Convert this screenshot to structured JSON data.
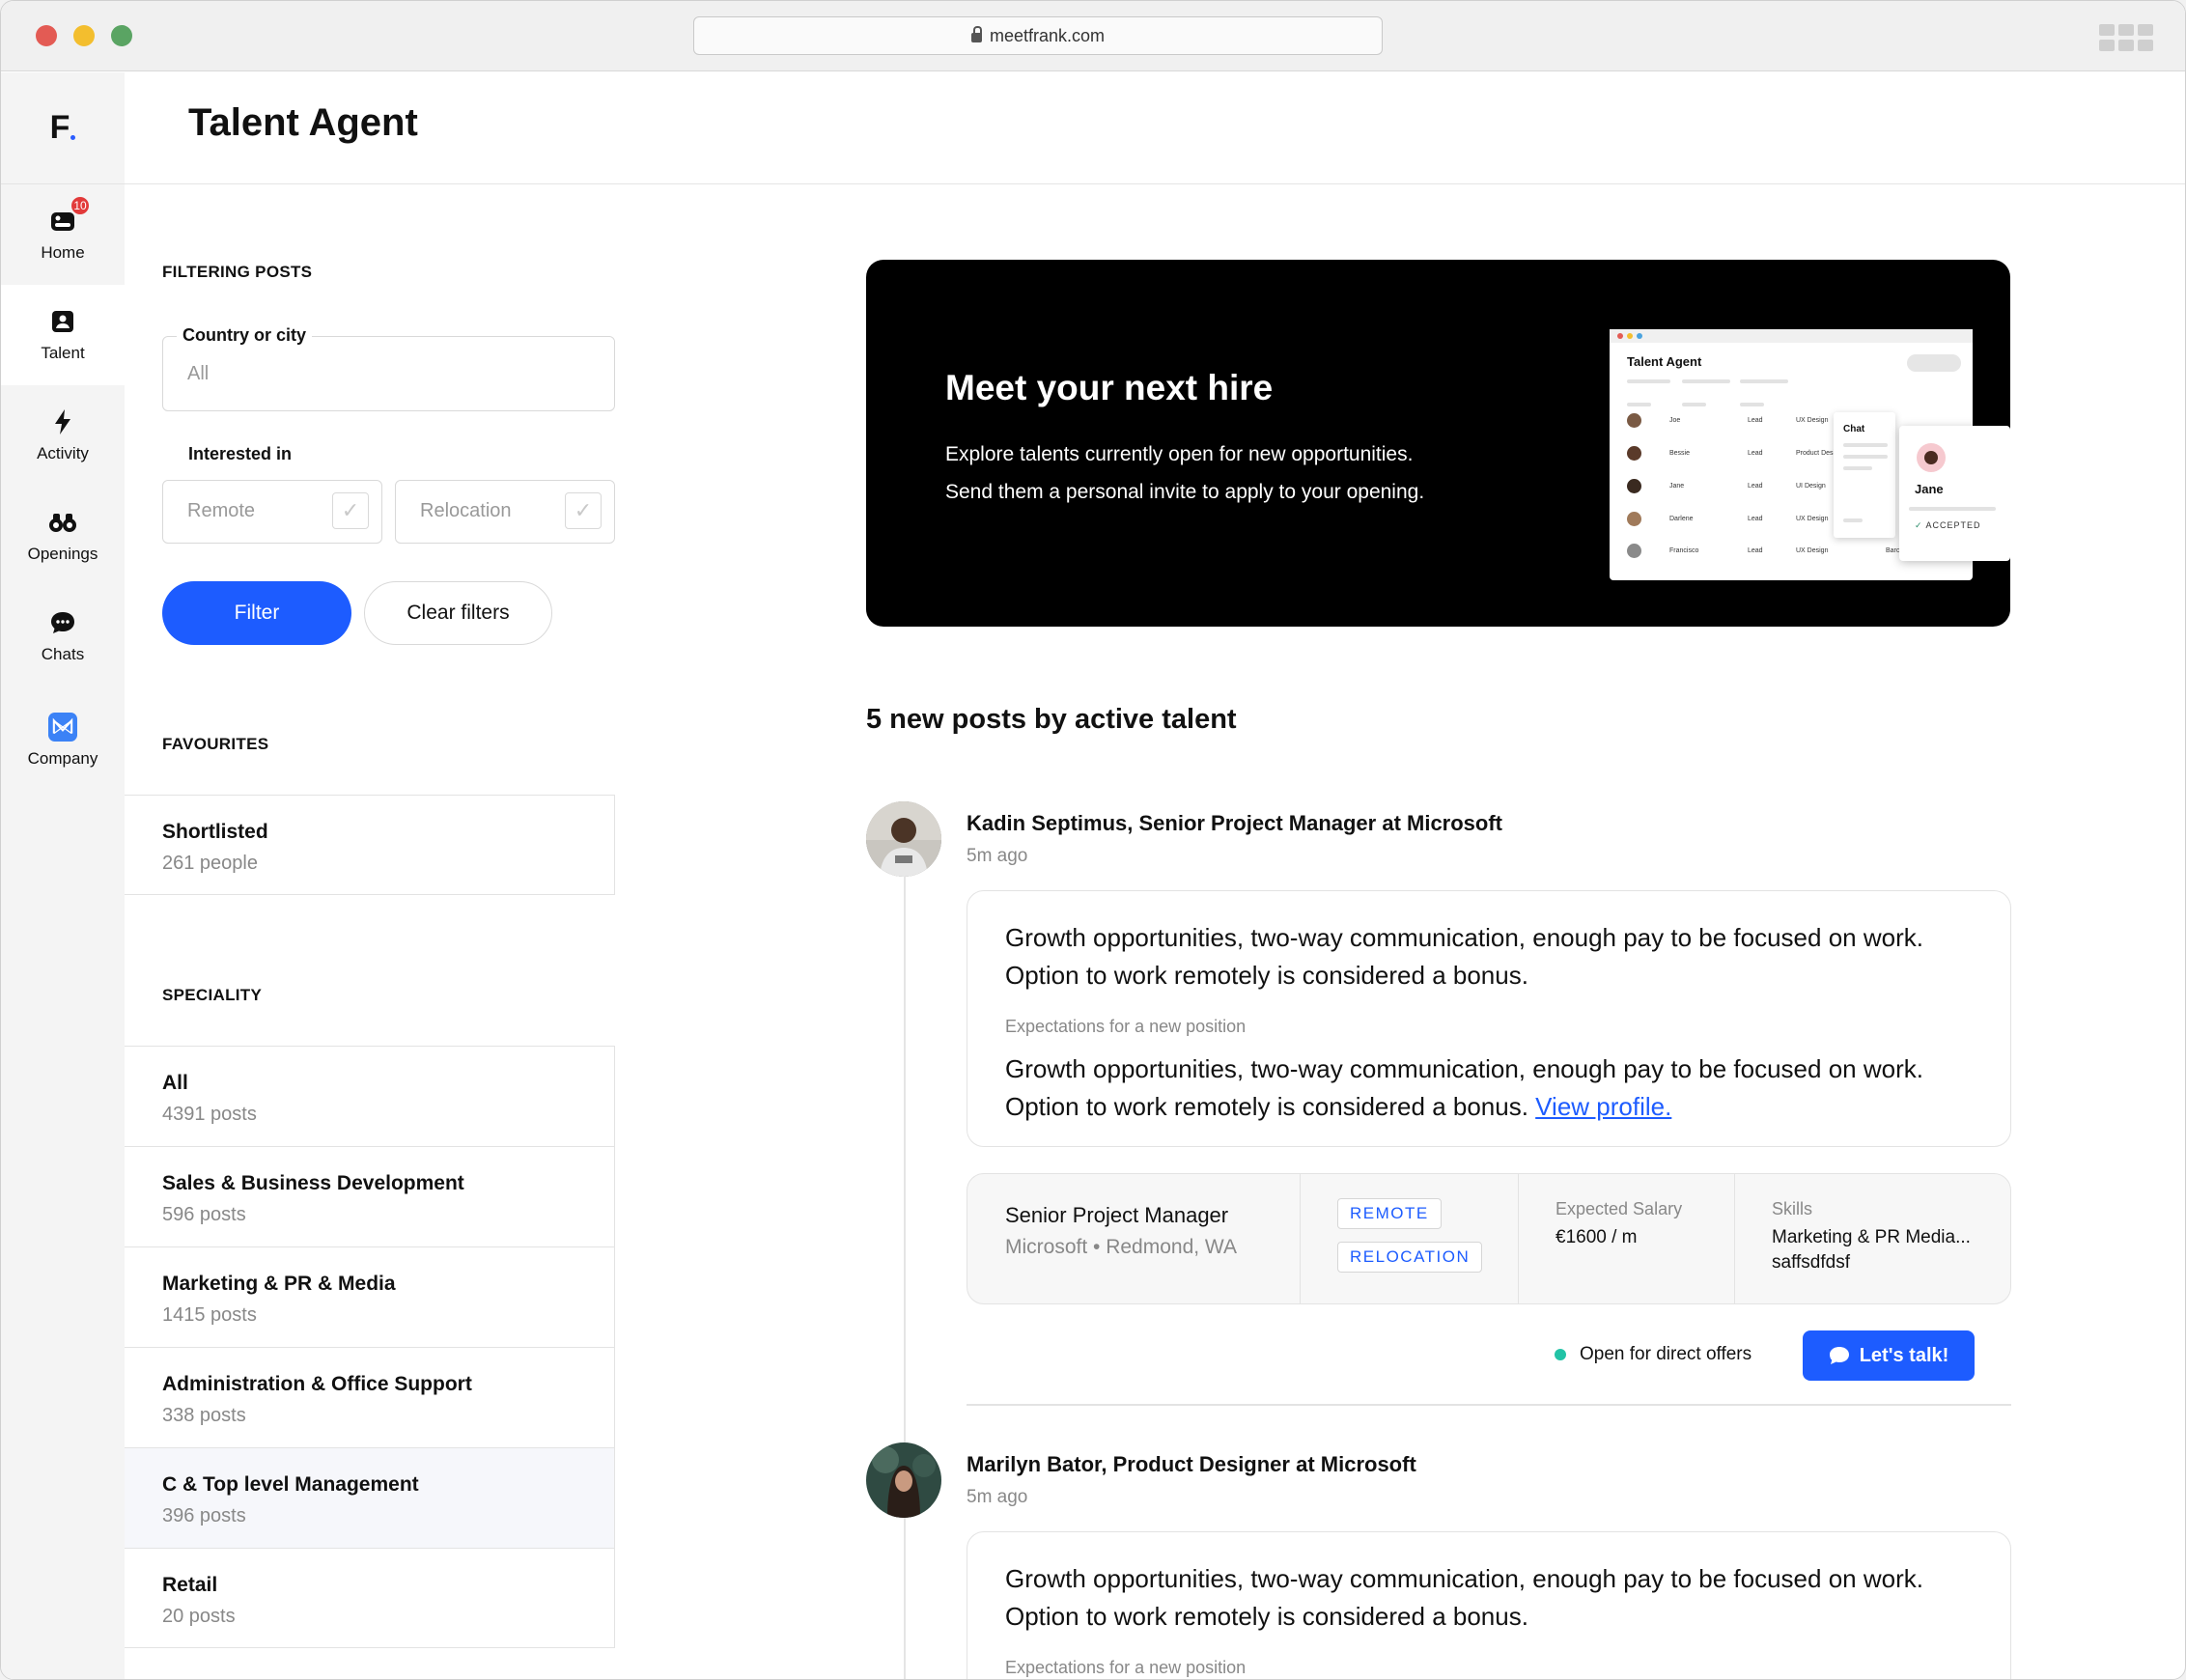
{
  "browser": {
    "url": "meetfrank.com"
  },
  "app": {
    "logo": "F",
    "page_title": "Talent Agent"
  },
  "nav": {
    "home": {
      "label": "Home",
      "badge": "10"
    },
    "talent": {
      "label": "Talent"
    },
    "activity": {
      "label": "Activity"
    },
    "openings": {
      "label": "Openings"
    },
    "chats": {
      "label": "Chats"
    },
    "company": {
      "label": "Company"
    }
  },
  "filters": {
    "section_title": "FILTERING POSTS",
    "location_label": "Country or city",
    "location_value": "All",
    "interest_label": "Interested in",
    "remote_label": "Remote",
    "relocation_label": "Relocation",
    "filter_button": "Filter",
    "clear_button": "Clear filters"
  },
  "favourites": {
    "section_title": "FAVOURITES",
    "items": [
      {
        "title": "Shortlisted",
        "sub": "261 people"
      }
    ]
  },
  "speciality": {
    "section_title": "SPECIALITY",
    "items": [
      {
        "title": "All",
        "sub": "4391 posts"
      },
      {
        "title": "Sales & Business Development",
        "sub": "596 posts"
      },
      {
        "title": "Marketing & PR & Media",
        "sub": "1415 posts"
      },
      {
        "title": "Administration & Office Support",
        "sub": "338 posts"
      },
      {
        "title": "C & Top level Management",
        "sub": "396 posts"
      },
      {
        "title": "Retail",
        "sub": "20 posts"
      }
    ]
  },
  "hero": {
    "title": "Meet your next hire",
    "line1": "Explore talents currently open for new opportunities.",
    "line2": "Send them a personal invite to apply to your opening.",
    "mock": {
      "title": "Talent Agent",
      "rows": [
        {
          "name": "Joe",
          "role": "Lead",
          "field": "UX Design"
        },
        {
          "name": "Bessie",
          "role": "Lead",
          "field": "Product Design"
        },
        {
          "name": "Jane",
          "role": "Lead",
          "field": "UI Design"
        },
        {
          "name": "Darlene",
          "role": "Lead",
          "field": "UX Design"
        },
        {
          "name": "Francisco",
          "role": "Lead",
          "field": "UX Design",
          "city": "Barcelona"
        }
      ],
      "chat_label": "Chat",
      "jane_name": "Jane",
      "accepted": "ACCEPTED"
    }
  },
  "feed": {
    "title": "5 new posts by active talent",
    "posts": [
      {
        "name": "Kadin Septimus",
        "headline": "Senior Project Manager at Microsoft",
        "time": "5m ago",
        "text1": "Growth opportunities, two-way communication, enough pay to be focused on work. Option to work remotely is considered a bonus.",
        "expect_label": "Expectations for a new position",
        "text2": "Growth opportunities, two-way communication, enough pay to be focused on work. Option to work remotely is considered a bonus.",
        "link": "View profile.",
        "position": "Senior Project Manager",
        "company_loc": "Microsoft • Redmond, WA",
        "tag1": "REMOTE",
        "tag2": "RELOCATION",
        "salary_label": "Expected Salary",
        "salary_value": "€1600 / m",
        "skills_label": "Skills",
        "skills_value1": "Marketing & PR Media...",
        "skills_value2": "saffsdfdsf",
        "status": "Open for direct offers",
        "cta": "Let's talk!"
      },
      {
        "name": "Marilyn Bator",
        "headline": "Product Designer at Microsoft",
        "time": "5m ago",
        "text1": "Growth opportunities, two-way communication, enough pay to be focused on work. Option to work remotely is considered a bonus.",
        "expect_label": "Expectations for a new position"
      }
    ]
  },
  "colors": {
    "accent": "#1d5cff",
    "status": "#22c3a6",
    "badge": "#e23a3a"
  }
}
